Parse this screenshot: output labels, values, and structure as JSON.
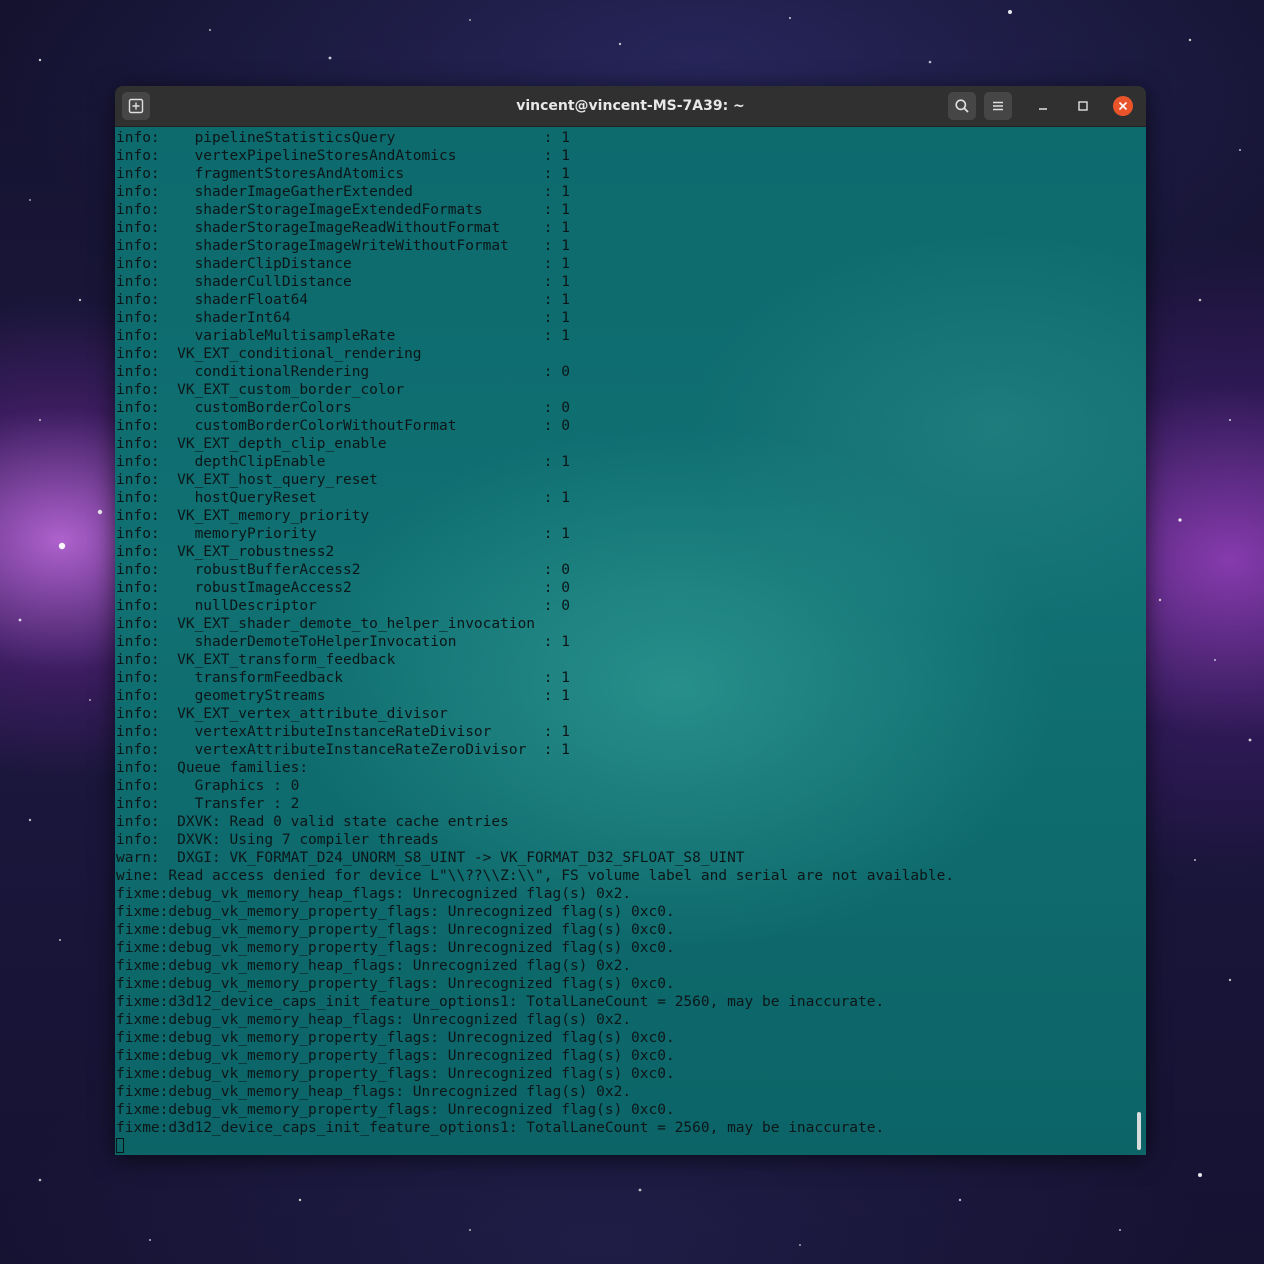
{
  "window": {
    "title": "vincent@vincent-MS-7A39: ~"
  },
  "icons": {
    "new_tab": "new-tab-icon",
    "search": "search-icon",
    "menu": "hamburger-menu-icon",
    "minimize": "minimize-icon",
    "maximize": "maximize-icon",
    "close": "close-icon"
  },
  "colors": {
    "close_button": "#e9542a",
    "terminal_bg": "#0e6b6e",
    "terminal_text": "#0c1618",
    "titlebar": "#303030"
  },
  "terminal": {
    "lines": [
      "info:    pipelineStatisticsQuery                 : 1",
      "info:    vertexPipelineStoresAndAtomics          : 1",
      "info:    fragmentStoresAndAtomics                : 1",
      "info:    shaderImageGatherExtended               : 1",
      "info:    shaderStorageImageExtendedFormats       : 1",
      "info:    shaderStorageImageReadWithoutFormat     : 1",
      "info:    shaderStorageImageWriteWithoutFormat    : 1",
      "info:    shaderClipDistance                      : 1",
      "info:    shaderCullDistance                      : 1",
      "info:    shaderFloat64                           : 1",
      "info:    shaderInt64                             : 1",
      "info:    variableMultisampleRate                 : 1",
      "info:  VK_EXT_conditional_rendering",
      "info:    conditionalRendering                    : 0",
      "info:  VK_EXT_custom_border_color",
      "info:    customBorderColors                      : 0",
      "info:    customBorderColorWithoutFormat          : 0",
      "info:  VK_EXT_depth_clip_enable",
      "info:    depthClipEnable                         : 1",
      "info:  VK_EXT_host_query_reset",
      "info:    hostQueryReset                          : 1",
      "info:  VK_EXT_memory_priority",
      "info:    memoryPriority                          : 1",
      "info:  VK_EXT_robustness2",
      "info:    robustBufferAccess2                     : 0",
      "info:    robustImageAccess2                      : 0",
      "info:    nullDescriptor                          : 0",
      "info:  VK_EXT_shader_demote_to_helper_invocation",
      "info:    shaderDemoteToHelperInvocation          : 1",
      "info:  VK_EXT_transform_feedback",
      "info:    transformFeedback                       : 1",
      "info:    geometryStreams                         : 1",
      "info:  VK_EXT_vertex_attribute_divisor",
      "info:    vertexAttributeInstanceRateDivisor      : 1",
      "info:    vertexAttributeInstanceRateZeroDivisor  : 1",
      "info:  Queue families:",
      "info:    Graphics : 0",
      "info:    Transfer : 2",
      "info:  DXVK: Read 0 valid state cache entries",
      "info:  DXVK: Using 7 compiler threads",
      "warn:  DXGI: VK_FORMAT_D24_UNORM_S8_UINT -> VK_FORMAT_D32_SFLOAT_S8_UINT",
      "wine: Read access denied for device L\"\\\\??\\\\Z:\\\\\", FS volume label and serial are not available.",
      "fixme:debug_vk_memory_heap_flags: Unrecognized flag(s) 0x2.",
      "fixme:debug_vk_memory_property_flags: Unrecognized flag(s) 0xc0.",
      "fixme:debug_vk_memory_property_flags: Unrecognized flag(s) 0xc0.",
      "fixme:debug_vk_memory_property_flags: Unrecognized flag(s) 0xc0.",
      "fixme:debug_vk_memory_heap_flags: Unrecognized flag(s) 0x2.",
      "fixme:debug_vk_memory_property_flags: Unrecognized flag(s) 0xc0.",
      "fixme:d3d12_device_caps_init_feature_options1: TotalLaneCount = 2560, may be inaccurate.",
      "fixme:debug_vk_memory_heap_flags: Unrecognized flag(s) 0x2.",
      "fixme:debug_vk_memory_property_flags: Unrecognized flag(s) 0xc0.",
      "fixme:debug_vk_memory_property_flags: Unrecognized flag(s) 0xc0.",
      "fixme:debug_vk_memory_property_flags: Unrecognized flag(s) 0xc0.",
      "fixme:debug_vk_memory_heap_flags: Unrecognized flag(s) 0x2.",
      "fixme:debug_vk_memory_property_flags: Unrecognized flag(s) 0xc0.",
      "fixme:d3d12_device_caps_init_feature_options1: TotalLaneCount = 2560, may be inaccurate."
    ]
  }
}
